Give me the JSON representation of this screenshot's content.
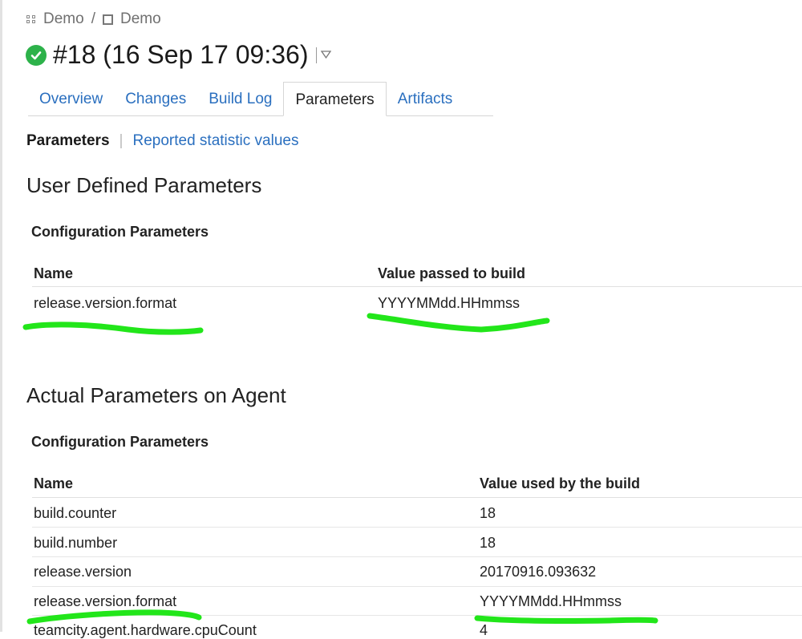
{
  "breadcrumb": {
    "project": "Demo",
    "separator": "/",
    "build_config": "Demo"
  },
  "header": {
    "title": "#18 (16 Sep 17 09:36)",
    "status": "success"
  },
  "tabs": [
    {
      "label": "Overview",
      "active": false
    },
    {
      "label": "Changes",
      "active": false
    },
    {
      "label": "Build Log",
      "active": false
    },
    {
      "label": "Parameters",
      "active": true
    },
    {
      "label": "Artifacts",
      "active": false
    }
  ],
  "subtabs": {
    "active": "Parameters",
    "separator": "|",
    "link": "Reported statistic values"
  },
  "user_defined": {
    "heading": "User Defined Parameters",
    "section": "Configuration Parameters",
    "columns": [
      "Name",
      "Value passed to build"
    ],
    "rows": [
      {
        "name": "release.version.format",
        "value": "YYYYMMdd.HHmmss"
      }
    ]
  },
  "actual": {
    "heading": "Actual Parameters on Agent",
    "section": "Configuration Parameters",
    "columns": [
      "Name",
      "Value used by the build"
    ],
    "rows": [
      {
        "name": "build.counter",
        "value": "18"
      },
      {
        "name": "build.number",
        "value": "18"
      },
      {
        "name": "release.version",
        "value": "20170916.093632"
      },
      {
        "name": "release.version.format",
        "value": "YYYYMMdd.HHmmss"
      },
      {
        "name": "teamcity.agent.hardware.cpuCount",
        "value": "4"
      }
    ]
  },
  "colors": {
    "link": "#2a6fbf",
    "success": "#2db24a",
    "highlight": "#22e61a"
  }
}
